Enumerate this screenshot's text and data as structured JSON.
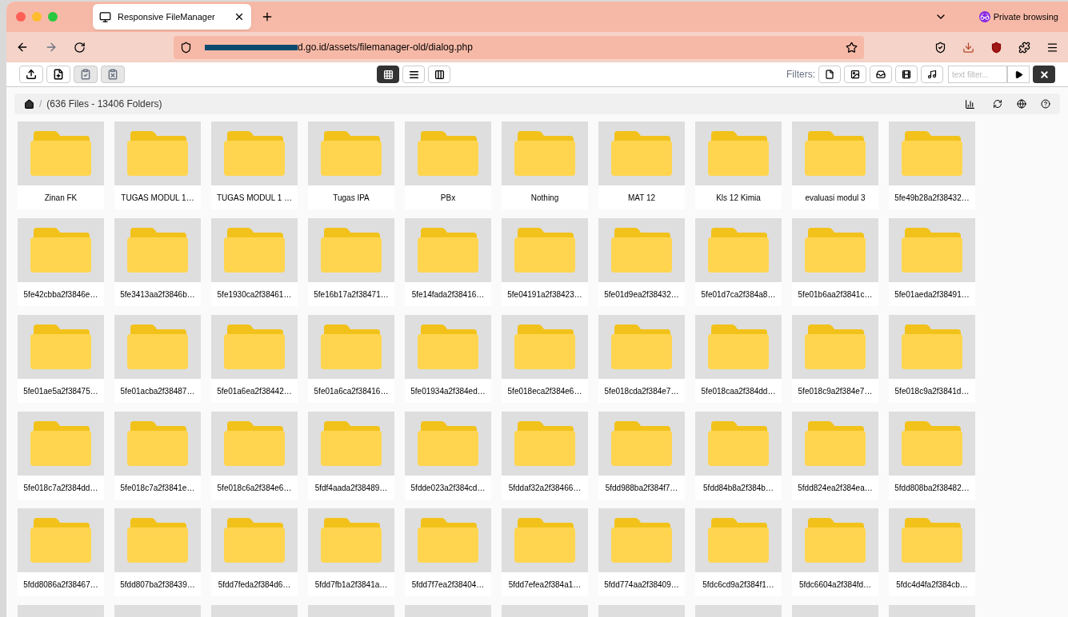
{
  "browser": {
    "tab": {
      "title": "Responsive FileManager",
      "selected": true
    },
    "private_label": "Private browsing",
    "url": "d.go.id/assets/filemanager-old/dialog.php"
  },
  "toolbar": {
    "actions": [
      {
        "kind": "upload",
        "disabled": false
      },
      {
        "kind": "new_file",
        "disabled": false
      },
      {
        "kind": "paste",
        "disabled": true
      },
      {
        "kind": "clear_clipboard",
        "disabled": true
      }
    ],
    "views": [
      {
        "kind": "grid",
        "selected": true
      },
      {
        "kind": "list",
        "selected": false
      },
      {
        "kind": "columns",
        "selected": false
      }
    ],
    "filters_label": "Filters:",
    "filters": [
      {
        "kind": "file"
      },
      {
        "kind": "image"
      },
      {
        "kind": "archive"
      },
      {
        "kind": "video"
      },
      {
        "kind": "music"
      }
    ],
    "text_filter": {
      "placeholder": "text filter..."
    }
  },
  "breadcrumb": {
    "separator": "/",
    "summary": "(636 Files - 13406 Folders)"
  },
  "folders": [
    "Zinan FK",
    "TUGAS MODUL 1…",
    "TUGAS MODUL 1 …",
    "Tugas IPA",
    "PBx",
    "Nothing",
    "MAT 12",
    "Kls 12 Kimia",
    "evaluasi modul 3",
    "5fe49b28a2f38432…",
    "5fe42cbba2f3846e…",
    "5fe3413aa2f3846b…",
    "5fe1930ca2f38461…",
    "5fe16b17a2f38471…",
    "5fe14fada2f38416…",
    "5fe04191a2f38423…",
    "5fe01d9ea2f38432…",
    "5fe01d7ca2f384a8…",
    "5fe01b6aa2f3841c…",
    "5fe01aeda2f38491…",
    "5fe01ae5a2f38475…",
    "5fe01acba2f38487…",
    "5fe01a6ea2f38442…",
    "5fe01a6ca2f38416…",
    "5fe01934a2f384ed…",
    "5fe018eca2f384e6…",
    "5fe018cda2f384e7…",
    "5fe018caa2f384dd…",
    "5fe018c9a2f384e7…",
    "5fe018c9a2f3841d…",
    "5fe018c7a2f384dd…",
    "5fe018c7a2f3841e…",
    "5fe018c6a2f384e6…",
    "5fdf4aada2f38489…",
    "5fdde023a2f384cd…",
    "5fddaf32a2f38466…",
    "5fdd988ba2f384f7…",
    "5fdd84b8a2f384b…",
    "5fdd824ea2f384ea…",
    "5fdd808ba2f38482…",
    "5fdd8086a2f38467…",
    "5fdd807ba2f38439…",
    "5fdd7feda2f384d6…",
    "5fdd7fb1a2f3841a…",
    "5fdd7f7ea2f38404…",
    "5fdd7efea2f384a1…",
    "5fdd774aa2f38409…",
    "5fdc6cd9a2f384f1…",
    "5fdc6604a2f384fd…",
    "5fdc4d4fa2f384cb…"
  ]
}
